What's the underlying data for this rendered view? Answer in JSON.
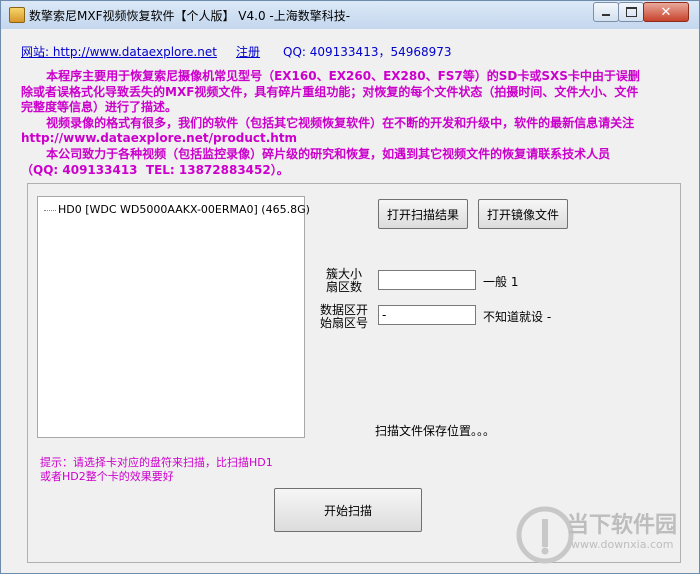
{
  "window": {
    "title": "数擎索尼MXF视频恢复软件【个人版】 V4.0 -上海数擎科技-",
    "controls": {
      "minimize": "minimize",
      "maximize": "maximize",
      "close": "✕"
    }
  },
  "header": {
    "website_label": "网站: http://www.dataexplore.net",
    "register_label": "注册",
    "qq_text": "QQ: 409133413，54968973"
  },
  "description": "      本程序主要用于恢复索尼摄像机常见型号（EX160、EX260、EX280、FS7等）的SD卡或SXS卡中由于误删除或者误格式化导致丢失的MXF视频文件，具有碎片重组功能；对恢复的每个文件状态（拍摄时间、文件大小、文件完整度等信息）进行了描述。\n      视频录像的格式有很多，我们的软件（包括其它视频恢复软件）在不断的开发和升级中，软件的最新信息请关注 http://www.dataexplore.net/product.htm\n      本公司致力于各种视频（包括监控录像）碎片级的研究和恢复，如遇到其它视频文件的恢复请联系技术人员（QQ: 409133413  TEL: 13872883452）。",
  "drive_tree": {
    "items": [
      {
        "label": "HD0   [WDC WD5000AAKX-00ERMA0]  (465.8G)"
      }
    ]
  },
  "buttons": {
    "open_scan_result": "打开扫描结果",
    "open_image_file": "打开镜像文件",
    "start_scan": "开始扫描"
  },
  "form": {
    "cluster_label": "簇大小\n扇区数",
    "cluster_value": "",
    "cluster_hint": "一般 1",
    "start_sector_label": "数据区开\n始扇区号",
    "start_sector_value": "-",
    "start_sector_hint": "不知道就设 -"
  },
  "save_location_label": "扫描文件保存位置。。。",
  "tip": "提示：请选择卡对应的盘符来扫描，比扫描HD1\n或者HD2整个卡的效果要好",
  "watermark": {
    "brand": "当下软件园",
    "url": "www.downxia.com"
  },
  "colors": {
    "magenta": "#cc00cc",
    "link_blue": "#0000cc",
    "window_bg": "#f0f0f0"
  }
}
